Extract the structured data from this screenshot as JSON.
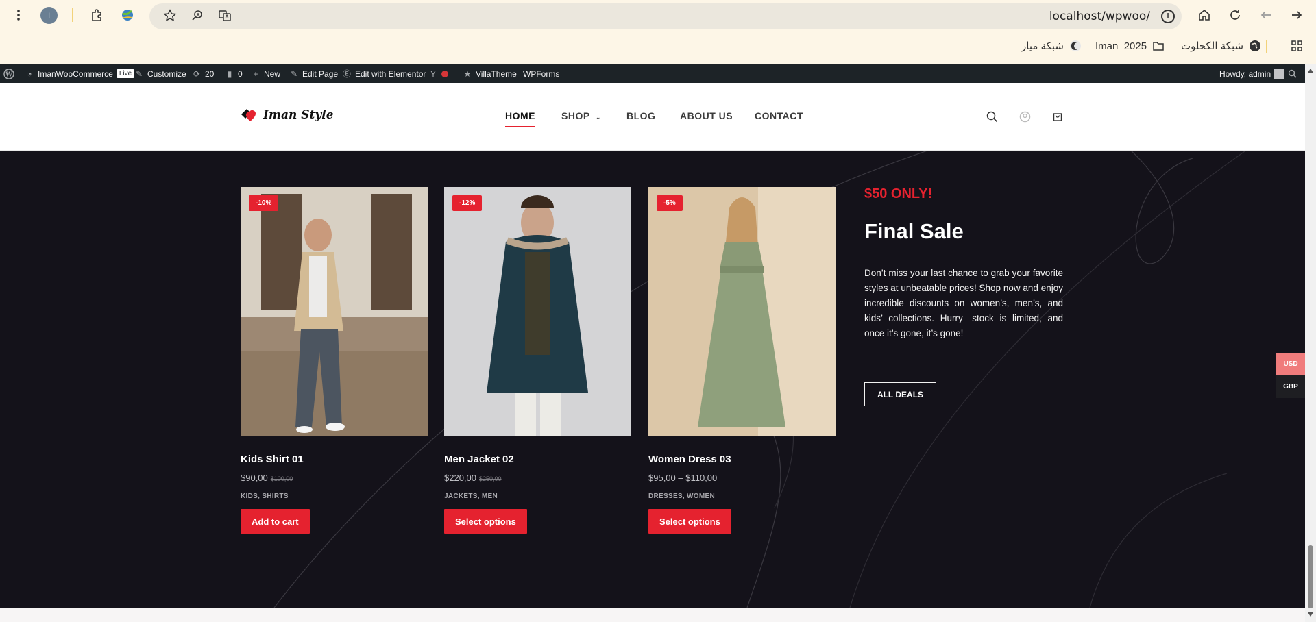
{
  "browser": {
    "url": "localhost/wpwoo/",
    "profile_initial": "I",
    "bookmarks": [
      {
        "label": "شبكة الكحلوت",
        "icon": "globe-icon"
      },
      {
        "label": "Iman_2025",
        "icon": "folder-icon"
      },
      {
        "label": "شبكة ميار",
        "icon": "site-icon"
      }
    ]
  },
  "adminbar": {
    "site_name": "ImanWooCommerce",
    "live": "Live",
    "customize": "Customize",
    "updates": "20",
    "comments": "0",
    "new": "New",
    "edit_page": "Edit Page",
    "edit_elementor": "Edit with Elementor",
    "villatheme": "VillaTheme",
    "wpforms": "WPForms",
    "howdy": "Howdy, admin"
  },
  "header": {
    "logo_text": "Iman Style",
    "nav": [
      {
        "label": "HOME",
        "active": true
      },
      {
        "label": "SHOP",
        "dropdown": true
      },
      {
        "label": "BLOG"
      },
      {
        "label": "ABOUT US"
      },
      {
        "label": "CONTACT"
      }
    ]
  },
  "products": [
    {
      "badge": "-10%",
      "title": "Kids Shirt 01",
      "price": "$90,00",
      "old_price": "$100,00",
      "categories": "KIDS, SHIRTS",
      "button": "Add to cart"
    },
    {
      "badge": "-12%",
      "title": "Men Jacket 02",
      "price": "$220,00",
      "old_price": "$250,00",
      "categories": "JACKETS, MEN",
      "button": "Select options"
    },
    {
      "badge": "-5%",
      "title": "Women Dress 03",
      "price": "$95,00 – $110,00",
      "old_price": "",
      "categories": "DRESSES, WOMEN",
      "button": "Select options"
    }
  ],
  "promo": {
    "tag": "$50 ONLY!",
    "title": "Final Sale",
    "text": "Don’t miss your last chance to grab your favorite styles at unbeatable prices! Shop now and enjoy incredible discounts on women’s, men’s, and kids’ collections. Hurry—stock is limited, and once it’s gone, it’s gone!",
    "button": "ALL DEALS"
  },
  "currency_switcher": {
    "active": "USD",
    "other": "GBP"
  },
  "colors": {
    "accent": "#e5222f",
    "dark_bg": "#14121a",
    "adminbar_bg": "#1d2327"
  }
}
